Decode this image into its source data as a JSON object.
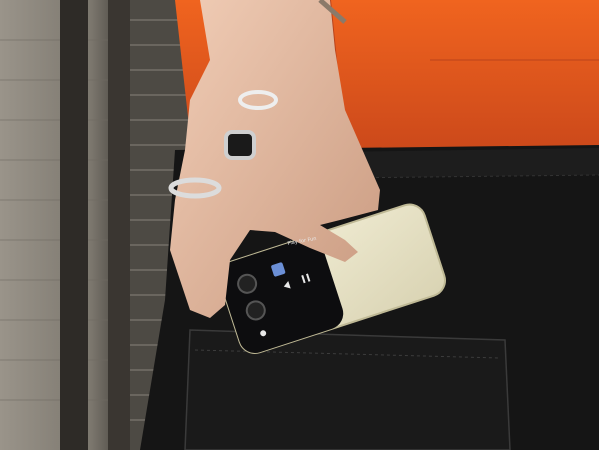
{
  "cover_screen": {
    "track_title": "Play for Fun",
    "controls": [
      "previous",
      "pause"
    ]
  },
  "colors": {
    "shirt": "#e2531c",
    "jeans": "#151515",
    "phone_body": "#e8e3c6",
    "brick": "#8f8a80"
  }
}
